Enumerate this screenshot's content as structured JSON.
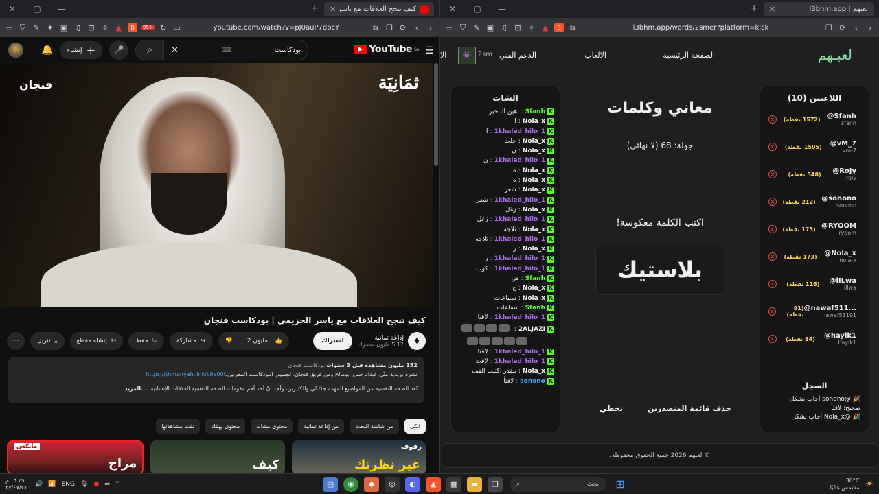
{
  "left_browser": {
    "tab_title": "كيف تنجح العلاقات مع ياسر الحز",
    "url": "youtube.com/watch?v=pJ0auP7dbcY",
    "badge_count": "99+"
  },
  "youtube": {
    "logo_text": "YouTube",
    "region": "SA",
    "search_query": "بودكاست",
    "create_label": "إنشاء",
    "player": {
      "brand_right": "ثمَانِيَة",
      "brand_left": "فنجان"
    },
    "video_title": "كيف تنجح العلاقات مع ياسر الحزيمي | بودكاست فنجان",
    "channel_name": "إذاعة ثمانية",
    "channel_subs": "5.12 مليون مشترك",
    "subscribe_label": "اشتراك",
    "like_count": "2 مليون",
    "share_label": "مشاركة",
    "save_label": "حفظ",
    "clip_label": "إنشاء مقطع",
    "download_label": "تنزيل",
    "description": {
      "views": "152 مليون مشاهدة  قبل 3 سنوات",
      "tag": "بودكاست فنجان",
      "line1": "نشره بريدية منّي عبدالرحمن أبومالح ومن فريق فنجان، لجمهور البودكاست المفربين.",
      "link": "https://thmanyah.link/c9e00f",
      "line2": "تُعد الصحة النفسية من المواضيع المهمة جدًا لي وللكثيرين، وأجد أنّ أحد أهم مقومات الصحة النفسية العلاقات الإنسانية.",
      "more": "...المزيد"
    },
    "chips": [
      {
        "label": "الكل",
        "active": true
      },
      {
        "label": "من شاشة البحث",
        "active": false
      },
      {
        "label": "من إذاعة ثمانية",
        "active": false
      },
      {
        "label": "محتوى مشابه",
        "active": false
      },
      {
        "label": "محتوى يهمّك",
        "active": false
      },
      {
        "label": "تمّت مشاهدتها",
        "active": false
      }
    ],
    "thumbs": [
      {
        "text": "مزاج",
        "badge": "مايكس"
      },
      {
        "text": "كيف",
        "badge": ""
      },
      {
        "text": "غير نظرتك",
        "badge": "رفوف"
      }
    ]
  },
  "right_browser": {
    "tab_title": "لعبهم | l3bhm.app",
    "url": "l3bhm.app/words/2smer?platform=kick"
  },
  "app": {
    "logo": "لعبـهم",
    "nav": [
      "الصفحة الرئيسية",
      "الالعاب",
      "الدعم الفني"
    ],
    "nav_extra": "الا",
    "user_short": "2sm",
    "game_title": "معاني وكلمات",
    "round": "جولة: 68 (لا نهائي)",
    "prompt": "اكتب الكلمة معكوسة!",
    "word": "بلاستيك",
    "clear_leaderboard": "حذف قائمة المتصدرين",
    "skip": "تخطي",
    "footer": "© لعبهم 2026 جميع الحقوق محفوظة.",
    "chat_title": "الشات",
    "chat": [
      {
        "user": "Sfanh",
        "color": "#53fc18",
        "msg": "اهين التاخير"
      },
      {
        "user": "Nola_x",
        "color": "#f1f1f1",
        "msg": "ا"
      },
      {
        "user": "1khaled_hilo_1",
        "color": "#b06cf0",
        "msg": "ا"
      },
      {
        "user": "Nola_x",
        "color": "#f1f1f1",
        "msg": "جلث"
      },
      {
        "user": "Nola_x",
        "color": "#f1f1f1",
        "msg": "ن"
      },
      {
        "user": "1khaled_hilo_1",
        "color": "#b06cf0",
        "msg": "ن"
      },
      {
        "user": "Nola_x",
        "color": "#f1f1f1",
        "msg": "ة"
      },
      {
        "user": "Nola_x",
        "color": "#f1f1f1",
        "msg": "ه"
      },
      {
        "user": "Nola_x",
        "color": "#f1f1f1",
        "msg": "شعر"
      },
      {
        "user": "1khaled_hilo_1",
        "color": "#b06cf0",
        "msg": "شعر"
      },
      {
        "user": "Nola_x",
        "color": "#f1f1f1",
        "msg": "زغل"
      },
      {
        "user": "1khaled_hilo_1",
        "color": "#b06cf0",
        "msg": "زغل"
      },
      {
        "user": "Nola_x",
        "color": "#f1f1f1",
        "msg": "ثلاجة"
      },
      {
        "user": "1khaled_hilo_1",
        "color": "#b06cf0",
        "msg": "ثلاجه"
      },
      {
        "user": "Nola_x",
        "color": "#f1f1f1",
        "msg": "ر"
      },
      {
        "user": "1khaled_hilo_1",
        "color": "#b06cf0",
        "msg": "ر"
      },
      {
        "user": "1khaled_hilo_1",
        "color": "#b06cf0",
        "msg": "كوب"
      },
      {
        "user": "Sfanh",
        "color": "#53fc18",
        "msg": "ض"
      },
      {
        "user": "Nola_x",
        "color": "#f1f1f1",
        "msg": "ج"
      },
      {
        "user": "Nola_x",
        "color": "#f1f1f1",
        "msg": "سماعات"
      },
      {
        "user": "Sfanh",
        "color": "#53fc18",
        "msg": "سماعات"
      },
      {
        "user": "1khaled_hilo_1",
        "color": "#b06cf0",
        "msg": "لاقتا"
      },
      {
        "user": "2ALJAZI",
        "color": "#f1f1f1",
        "msg": "",
        "emotes": 9
      },
      {
        "user": "1khaled_hilo_1",
        "color": "#b06cf0",
        "msg": "لاقتا"
      },
      {
        "user": "1khaled_hilo_1",
        "color": "#b06cf0",
        "msg": "لاقث"
      },
      {
        "user": "Nola_x",
        "color": "#f1f1f1",
        "msg": "مقدر اكتيب الفف"
      },
      {
        "user": "sonono",
        "color": "#3ea6ff",
        "msg": "لاقتأ"
      }
    ],
    "players_title": "اللاعبين (10)",
    "players": [
      {
        "name": "@Sfanh",
        "id": "sfanh",
        "score": "(1572 نقطة)"
      },
      {
        "name": "@vM_7",
        "id": "vm-7",
        "score": "(1505 نقطة)"
      },
      {
        "name": "@RoJy",
        "id": "roly",
        "score": "(548 نقطة)"
      },
      {
        "name": "@sonono",
        "id": "sonono",
        "score": "(212 نقطة)"
      },
      {
        "name": "@RYOOM",
        "id": "ryoom",
        "score": "(175 نقطة)"
      },
      {
        "name": "@Nola_x",
        "id": "nola-x",
        "score": "(173 نقطة)"
      },
      {
        "name": "@lILwa",
        "id": "illwa",
        "score": "(116 نقطة)"
      },
      {
        "name": "@nawaf511...",
        "id": "nawaf51191",
        "score": "(91 نقطة)"
      },
      {
        "name": "@haylk1",
        "id": "haylk1",
        "score": "(84 نقطة)"
      }
    ],
    "log_title": "السجل",
    "log": [
      "🎉 @sonono أجاب بشكل",
      "صحيح: لاقتأ!",
      "🎉 @Nola_x أجاب بشكل"
    ]
  },
  "taskbar": {
    "search_placeholder": "بحث",
    "lang": "ENG",
    "time": "٠٦:٣٩ م",
    "date": "٢٧/٠٧/٢٧",
    "weather_temp": "30°C",
    "weather_desc": "مشمس غالبًا"
  }
}
